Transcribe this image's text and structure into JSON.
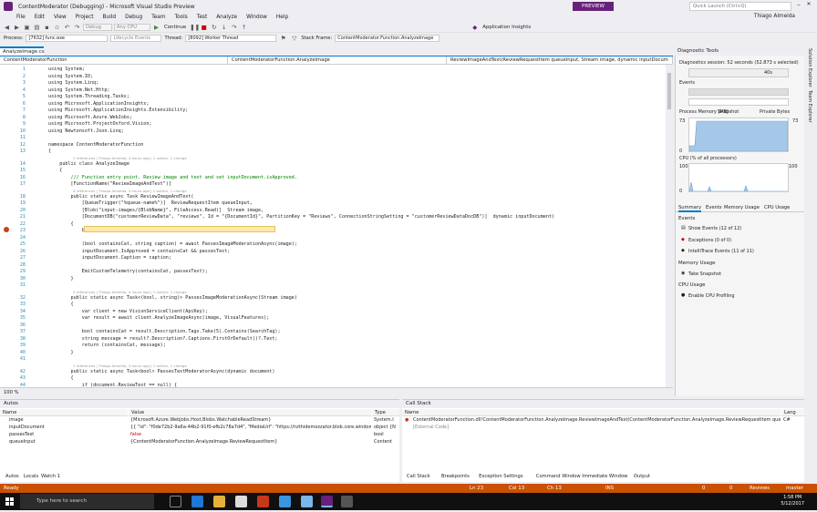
{
  "window": {
    "title": "ContentModerator (Debugging) - Microsoft Visual Studio Preview",
    "preview_badge": "PREVIEW",
    "quick_launch_placeholder": "Quick Launch (Ctrl+Q)",
    "user": "Thiago Almeida"
  },
  "menu": [
    "File",
    "Edit",
    "View",
    "Project",
    "Build",
    "Debug",
    "Team",
    "Tools",
    "Test",
    "Analyze",
    "Window",
    "Help"
  ],
  "toolbar": {
    "config": "Debug",
    "platform": "Any CPU",
    "continue_label": "Continue",
    "app_insights": "Application Insights"
  },
  "debugbar": {
    "process_label": "Process:",
    "process_value": "[7632] func.exe",
    "lifecycle": "Lifecycle Events",
    "thread_label": "Thread:",
    "thread_value": "[8092] Worker Thread",
    "stack_label": "Stack Frame:",
    "stack_value": "ContentModerator.Function.AnalyzeImage"
  },
  "editor": {
    "tab": "AnalyzeImage.cs",
    "nav": [
      "ContentModeratorFunction",
      "ContentModeratorFunction.AnalyzeImage",
      "ReviewImageAndText(ReviewRequestItem queueInput, Stream image, dynamic inputDocum"
    ],
    "zoom": "100 %",
    "lines": [
      {
        "n": "1",
        "t": "using System;"
      },
      {
        "n": "2",
        "t": "using System.IO;"
      },
      {
        "n": "3",
        "t": "using System.Linq;"
      },
      {
        "n": "4",
        "t": "using System.Net.Http;"
      },
      {
        "n": "5",
        "t": "using System.Threading.Tasks;"
      },
      {
        "n": "6",
        "t": "using Microsoft.ApplicationInsights;"
      },
      {
        "n": "7",
        "t": "using Microsoft.ApplicationInsights.Extensibility;"
      },
      {
        "n": "8",
        "t": "using Microsoft.Azure.WebJobs;"
      },
      {
        "n": "9",
        "t": "using Microsoft.ProjectOxford.Vision;"
      },
      {
        "n": "10",
        "t": "using Newtonsoft.Json.Linq;"
      },
      {
        "n": "11",
        "t": ""
      },
      {
        "n": "12",
        "t": "namespace ContentModeratorFunction"
      },
      {
        "n": "13",
        "t": "{"
      },
      {
        "n": "",
        "lens": "2 references | Thiago Almeida, 4 hours ago | 1 author, 1 change"
      },
      {
        "n": "14",
        "t": "    public class AnalyzeImage"
      },
      {
        "n": "15",
        "t": "    {"
      },
      {
        "n": "16",
        "t": "        /// Function entry point. Review image and text and set inputDocument.isApproved."
      },
      {
        "n": "17",
        "t": "        [FunctionName(\"ReviewImageAndText\")]"
      },
      {
        "n": "",
        "lens": "0 references | Thiago Almeida, 4 hours ago | 1 author, 1 change"
      },
      {
        "n": "18",
        "t": "        public static async Task ReviewImageAndText("
      },
      {
        "n": "19",
        "t": "            [QueueTrigger(\"%queue-name%\")]  ReviewRequestItem queueInput,"
      },
      {
        "n": "20",
        "t": "            [Blob(\"input-images/{BlobName}\", FileAccess.Read)]  Stream image,"
      },
      {
        "n": "21",
        "t": "            [DocumentDB(\"customerReviewData\", \"reviews\", Id = \"{DocumentId}\", PartitionKey = \"Reviews\", ConnectionStringSetting = \"customerReviewDataDocDB\")]  dynamic inputDocument)"
      },
      {
        "n": "22",
        "t": "        {"
      },
      {
        "n": "23",
        "t": "            bool passesText = await PassesTextModeratorAsync(inputDocument);"
      },
      {
        "n": "24",
        "t": ""
      },
      {
        "n": "25",
        "t": "            (bool containsCat, string caption) = await PassesImageModerationAsync(image);"
      },
      {
        "n": "26",
        "t": "            inputDocument.IsApproved = containsCat && passesText;"
      },
      {
        "n": "27",
        "t": "            inputDocument.Caption = caption;"
      },
      {
        "n": "28",
        "t": ""
      },
      {
        "n": "29",
        "t": "            EmitCustomTelemetry(containsCat, passesText);"
      },
      {
        "n": "30",
        "t": "        }"
      },
      {
        "n": "31",
        "t": ""
      },
      {
        "n": "",
        "lens": "2 references | Thiago Almeida, 4 hours ago | 1 author, 1 change"
      },
      {
        "n": "32",
        "t": "        public static async Task<(bool, string)> PassesImageModerationAsync(Stream image)"
      },
      {
        "n": "33",
        "t": "        {"
      },
      {
        "n": "34",
        "t": "            var client = new VisionServiceClient(ApiKey);"
      },
      {
        "n": "35",
        "t": "            var result = await client.AnalyzeImageAsync(image, VisualFeatures);"
      },
      {
        "n": "36",
        "t": ""
      },
      {
        "n": "37",
        "t": "            bool containsCat = result.Description.Tags.Take(5).Contains(SearchTag);"
      },
      {
        "n": "38",
        "t": "            string message = result?.Description?.Captions.FirstOrDefault()?.Text;"
      },
      {
        "n": "39",
        "t": "            return (containsCat, message);"
      },
      {
        "n": "40",
        "t": "        }"
      },
      {
        "n": "41",
        "t": ""
      },
      {
        "n": "",
        "lens": "2 references | Thiago Almeida, 4 hours ago | 1 author, 1 change"
      },
      {
        "n": "42",
        "t": "        public static async Task<bool> PassesTextModeratorAsync(dynamic document)"
      },
      {
        "n": "43",
        "t": "        {"
      },
      {
        "n": "44",
        "t": "            if (document.ReviewText == null) {"
      }
    ]
  },
  "diagnostics": {
    "title": "Diagnostic Tools",
    "session": "Diagnostics session: 52 seconds (52.873 s selected)",
    "time_mark": "40s",
    "events_label": "Events",
    "memory_label": "Process Memory (MB)",
    "snapshot": "Snapshot",
    "private_bytes": "Private Bytes",
    "mem_max": "73",
    "mem_min": "0",
    "cpu_label": "CPU (% of all processors)",
    "cpu_max": "100",
    "cpu_min": "0",
    "tabs": [
      "Summary",
      "Events",
      "Memory Usage",
      "CPU Usage"
    ],
    "events_section": "Events",
    "show_events": "Show Events (12 of 12)",
    "exceptions": "Exceptions (0 of 0)",
    "intellitrace": "IntelliTrace Events (11 of 11)",
    "memory_section": "Memory Usage",
    "take_snapshot": "Take Snapshot",
    "cpu_section": "CPU Usage",
    "enable_cpu": "Enable CPU Profiling"
  },
  "rail": [
    "Solution Explorer",
    "Team Explorer"
  ],
  "autos": {
    "title": "Autos",
    "headers": [
      "Name",
      "Value",
      "Type"
    ],
    "rows": [
      {
        "name": "image",
        "value": "{Microsoft.Azure.WebJobs.Host.Blobs.WatchableReadStream}",
        "type": "System.I"
      },
      {
        "name": "inputDocument",
        "value": "{{  \"id\": \"f0de72b2-9a6a-44b2-91f0-efb2c78a7d4\",  \"MediaUrl\": \"https://nzthidemozzator.blob.core.windows.n...",
        "type": "object {N"
      },
      {
        "name": "passesText",
        "value": "false",
        "type": "bool"
      },
      {
        "name": "queueInput",
        "value": "{ContentModeratorFunction.AnalyzeImage.ReviewRequestItem}",
        "type": "Content"
      }
    ],
    "tabs": [
      "Autos",
      "Locals",
      "Watch 1"
    ]
  },
  "callstack": {
    "title": "Call Stack",
    "headers": [
      "Name",
      "Lang"
    ],
    "rows": [
      {
        "name": "ContentModeratorFunction.dll!ContentModeratorFunction.AnalyzeImage.ReviewImageAndText(ContentModeratorFunction.AnalyzeImage.ReviewRequestItem queueInput, S",
        "lang": "C#"
      },
      {
        "name": "[External Code]",
        "lang": ""
      }
    ],
    "tabs": [
      "Call Stack",
      "Breakpoints",
      "Exception Settings",
      "Command Window",
      "Immediate Window",
      "Output"
    ]
  },
  "status": {
    "ready": "Ready",
    "ln": "Ln 23",
    "col": "Col 13",
    "ch": "Ch 13",
    "ins": "INS",
    "up": "0",
    "edits": "0",
    "repo": "Reviews",
    "branch": "master"
  },
  "taskbar": {
    "search": "Type here to search",
    "time": "1:58 PM",
    "date": "5/12/2017"
  },
  "colors": {
    "status_bg": "#ca5100",
    "accent": "#007acc",
    "vs_purple": "#68217a"
  }
}
